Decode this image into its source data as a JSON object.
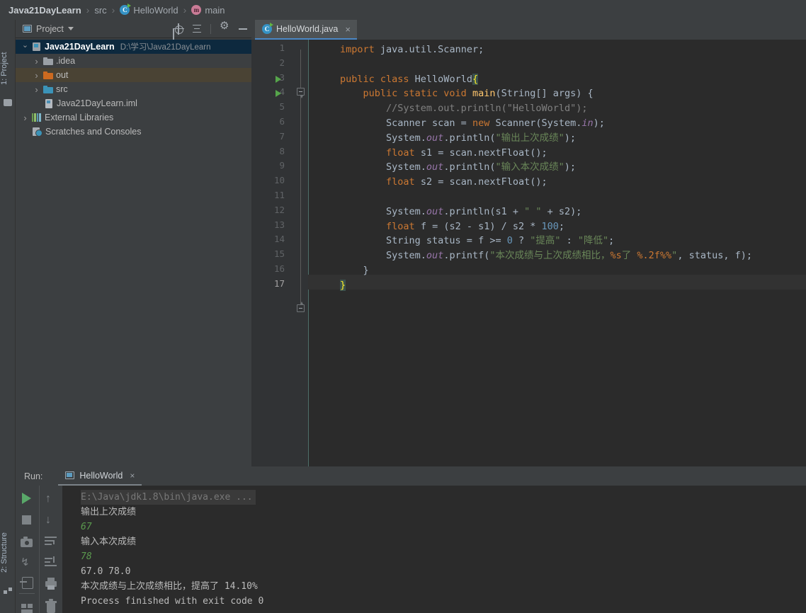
{
  "breadcrumb": {
    "items": [
      {
        "label": "Java21DayLearn",
        "icon": null,
        "bold": true
      },
      {
        "label": "src",
        "icon": null,
        "bold": false
      },
      {
        "label": "HelloWorld",
        "icon": "class-icon",
        "bold": false
      },
      {
        "label": "main",
        "icon": "method-icon",
        "bold": false
      }
    ],
    "separator": "›"
  },
  "left_strip": {
    "project_label": "1: Project",
    "structure_label": "2: Structure",
    "project_icon": "folder-icon",
    "structure_icon": "structure-icon"
  },
  "project_panel": {
    "title": "Project",
    "dropdown_icon": "chevron-down-icon",
    "window_icon": "project-window-icon",
    "tools": [
      {
        "name": "locate-icon",
        "title": "Select Opened File"
      },
      {
        "name": "collapse-all-icon",
        "title": "Collapse All"
      },
      {
        "name": "gear-icon",
        "title": "Settings"
      },
      {
        "name": "minimize-icon",
        "title": "Hide"
      }
    ],
    "tree": [
      {
        "label": "Java21DayLearn",
        "path": "D:\\学习\\Java21DayLearn",
        "icon": "module-icon",
        "arrow": "open",
        "indent": 1,
        "state": "selected",
        "bold": true
      },
      {
        "label": ".idea",
        "path": "",
        "icon": "folder-gray-icon",
        "arrow": "closed",
        "indent": 2,
        "state": "normal",
        "bold": false
      },
      {
        "label": "out",
        "path": "",
        "icon": "folder-orange-icon",
        "arrow": "closed",
        "indent": 2,
        "state": "highlighted",
        "bold": false
      },
      {
        "label": "src",
        "path": "",
        "icon": "folder-blue-icon",
        "arrow": "closed",
        "indent": 2,
        "state": "normal",
        "bold": false
      },
      {
        "label": "Java21DayLearn.iml",
        "path": "",
        "icon": "iml-file-icon",
        "arrow": "none",
        "indent": 3,
        "state": "normal",
        "bold": false
      },
      {
        "label": "External Libraries",
        "path": "",
        "icon": "libraries-icon",
        "arrow": "closed",
        "indent": 1,
        "state": "normal",
        "bold": false
      },
      {
        "label": "Scratches and Consoles",
        "path": "",
        "icon": "scratches-icon",
        "arrow": "none",
        "indent": 2,
        "state": "normal",
        "bold": false
      }
    ]
  },
  "editor": {
    "tab": {
      "label": "HelloWorld.java",
      "icon": "java-class-icon",
      "close": "×"
    },
    "active_line": 17,
    "lines": [
      {
        "n": 1,
        "runmark": false,
        "tokens": [
          {
            "t": "import ",
            "c": "kw"
          },
          {
            "t": "java.util.Scanner;",
            "c": "plain"
          }
        ]
      },
      {
        "n": 2,
        "runmark": false,
        "tokens": []
      },
      {
        "n": 3,
        "runmark": true,
        "tokens": [
          {
            "t": "public class ",
            "c": "kw"
          },
          {
            "t": "HelloWorld",
            "c": "plain"
          },
          {
            "t": "{",
            "c": "brace-hl"
          }
        ]
      },
      {
        "n": 4,
        "runmark": true,
        "tokens": [
          {
            "t": "    public static void ",
            "c": "kw"
          },
          {
            "t": "main",
            "c": "mth"
          },
          {
            "t": "(String[] args) {",
            "c": "plain"
          }
        ]
      },
      {
        "n": 5,
        "runmark": false,
        "tokens": [
          {
            "t": "        //System.out.println(\"HelloWorld\");",
            "c": "cmt"
          }
        ]
      },
      {
        "n": 6,
        "runmark": false,
        "tokens": [
          {
            "t": "        Scanner scan = ",
            "c": "plain"
          },
          {
            "t": "new ",
            "c": "kw"
          },
          {
            "t": "Scanner(System.",
            "c": "plain"
          },
          {
            "t": "in",
            "c": "fld"
          },
          {
            "t": ");",
            "c": "plain"
          }
        ]
      },
      {
        "n": 7,
        "runmark": false,
        "tokens": [
          {
            "t": "        System.",
            "c": "plain"
          },
          {
            "t": "out",
            "c": "fld"
          },
          {
            "t": ".println(",
            "c": "plain"
          },
          {
            "t": "\"输出上次成绩\"",
            "c": "str"
          },
          {
            "t": ");",
            "c": "plain"
          }
        ]
      },
      {
        "n": 8,
        "runmark": false,
        "tokens": [
          {
            "t": "        ",
            "c": "plain"
          },
          {
            "t": "float ",
            "c": "kw"
          },
          {
            "t": "s1 = scan.nextFloat();",
            "c": "plain"
          }
        ]
      },
      {
        "n": 9,
        "runmark": false,
        "tokens": [
          {
            "t": "        System.",
            "c": "plain"
          },
          {
            "t": "out",
            "c": "fld"
          },
          {
            "t": ".println(",
            "c": "plain"
          },
          {
            "t": "\"输入本次成绩\"",
            "c": "str"
          },
          {
            "t": ");",
            "c": "plain"
          }
        ]
      },
      {
        "n": 10,
        "runmark": false,
        "tokens": [
          {
            "t": "        ",
            "c": "plain"
          },
          {
            "t": "float ",
            "c": "kw"
          },
          {
            "t": "s2 = scan.nextFloat();",
            "c": "plain"
          }
        ]
      },
      {
        "n": 11,
        "runmark": false,
        "tokens": []
      },
      {
        "n": 12,
        "runmark": false,
        "tokens": [
          {
            "t": "        System.",
            "c": "plain"
          },
          {
            "t": "out",
            "c": "fld"
          },
          {
            "t": ".println(s1 + ",
            "c": "plain"
          },
          {
            "t": "\" \"",
            "c": "str"
          },
          {
            "t": " + s2);",
            "c": "plain"
          }
        ]
      },
      {
        "n": 13,
        "runmark": false,
        "tokens": [
          {
            "t": "        ",
            "c": "plain"
          },
          {
            "t": "float ",
            "c": "kw"
          },
          {
            "t": "f = (s2 - s1) / s2 * ",
            "c": "plain"
          },
          {
            "t": "100",
            "c": "num"
          },
          {
            "t": ";",
            "c": "plain"
          }
        ]
      },
      {
        "n": 14,
        "runmark": false,
        "tokens": [
          {
            "t": "        String status = f >= ",
            "c": "plain"
          },
          {
            "t": "0",
            "c": "num"
          },
          {
            "t": " ? ",
            "c": "plain"
          },
          {
            "t": "\"提高\"",
            "c": "str"
          },
          {
            "t": " : ",
            "c": "plain"
          },
          {
            "t": "\"降低\"",
            "c": "str"
          },
          {
            "t": ";",
            "c": "plain"
          }
        ]
      },
      {
        "n": 15,
        "runmark": false,
        "tokens": [
          {
            "t": "        System.",
            "c": "plain"
          },
          {
            "t": "out",
            "c": "fld"
          },
          {
            "t": ".printf(",
            "c": "plain"
          },
          {
            "t": "\"本次成绩与上次成绩相比，",
            "c": "str"
          },
          {
            "t": "%s",
            "c": "fmt"
          },
          {
            "t": "了 ",
            "c": "str"
          },
          {
            "t": "%.2f%%",
            "c": "fmt"
          },
          {
            "t": "\"",
            "c": "str"
          },
          {
            "t": ", status, f);",
            "c": "plain"
          }
        ]
      },
      {
        "n": 16,
        "runmark": false,
        "tokens": [
          {
            "t": "    }",
            "c": "plain"
          }
        ]
      },
      {
        "n": 17,
        "runmark": false,
        "tokens": [
          {
            "t": "}",
            "c": "brace-hl"
          }
        ]
      }
    ]
  },
  "run_panel": {
    "label": "Run:",
    "tab": {
      "label": "HelloWorld",
      "icon": "run-config-icon",
      "close": "×"
    },
    "toolbar_left": [
      {
        "name": "rerun-icon",
        "title": "Rerun"
      },
      {
        "name": "stop-icon",
        "title": "Stop"
      },
      {
        "name": "camera-icon",
        "title": "Dump Threads"
      },
      {
        "name": "thread-dump-icon",
        "title": "Thread Dump"
      },
      {
        "name": "import-icon",
        "title": "Restore Layout"
      },
      {
        "name": "layout-icon",
        "title": "Layout Settings"
      }
    ],
    "toolbar_right": [
      {
        "name": "arrow-up-icon",
        "title": "Up the stack trace"
      },
      {
        "name": "arrow-down-icon",
        "title": "Down the stack trace"
      },
      {
        "name": "soft-wrap-icon",
        "title": "Use Soft Wraps"
      },
      {
        "name": "scroll-to-end-icon",
        "title": "Scroll to End"
      },
      {
        "name": "print-icon",
        "title": "Print"
      },
      {
        "name": "trash-icon",
        "title": "Clear All"
      }
    ],
    "output": [
      {
        "text": "E:\\Java\\jdk1.8\\bin\\java.exe ...",
        "style": "cmd"
      },
      {
        "text": "输出上次成绩",
        "style": "normal"
      },
      {
        "text": "67",
        "style": "input"
      },
      {
        "text": "输入本次成绩",
        "style": "normal"
      },
      {
        "text": "78",
        "style": "input"
      },
      {
        "text": "67.0 78.0",
        "style": "normal"
      },
      {
        "text": "本次成绩与上次成绩相比，提高了 14.10%",
        "style": "normal"
      },
      {
        "text": "Process finished with exit code 0",
        "style": "normal"
      }
    ]
  },
  "colors": {
    "accent": "#4a88c7",
    "selection": "#0d293e",
    "highlight": "#4a4334",
    "editor_bg": "#2b2b2b",
    "panel_bg": "#3c3f41",
    "keyword": "#cc7832",
    "string": "#6a8759",
    "number": "#6897bb",
    "comment": "#808080",
    "field": "#9876aa",
    "method": "#ffc66d",
    "run_green": "#59a869"
  }
}
